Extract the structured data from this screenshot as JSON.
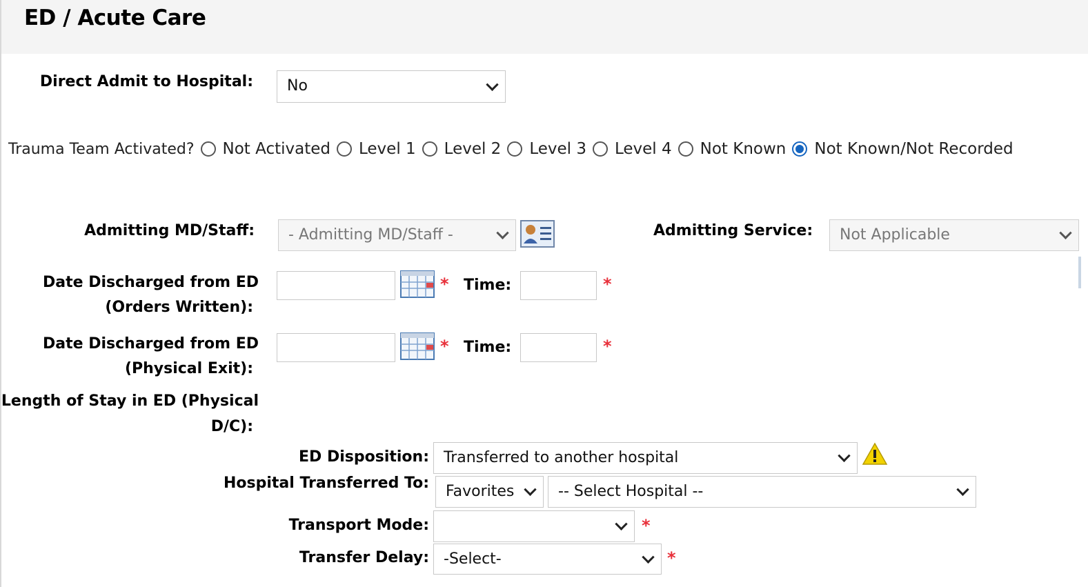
{
  "section": {
    "title": "ED / Acute Care"
  },
  "direct_admit": {
    "label": "Direct Admit to Hospital:",
    "value": "No"
  },
  "trauma": {
    "label": "Trauma Team Activated?",
    "options": [
      {
        "label": "Not Activated",
        "checked": false
      },
      {
        "label": "Level 1",
        "checked": false
      },
      {
        "label": "Level 2",
        "checked": false
      },
      {
        "label": "Level 3",
        "checked": false
      },
      {
        "label": "Level 4",
        "checked": false
      },
      {
        "label": "Not Known",
        "checked": false
      },
      {
        "label": "Not Known/Not Recorded",
        "checked": true
      }
    ]
  },
  "admitting_md": {
    "label": "Admitting MD/Staff:",
    "value": "- Admitting MD/Staff -"
  },
  "admitting_service": {
    "label": "Admitting Service:",
    "value": "Not Applicable"
  },
  "discharge_orders": {
    "label_line1": "Date Discharged from ED",
    "label_line2": "(Orders Written):",
    "date_value": "",
    "time_label": "Time:",
    "time_value": "",
    "required_mark": "*"
  },
  "discharge_exit": {
    "label_line1": "Date Discharged from ED",
    "label_line2": "(Physical Exit):",
    "date_value": "",
    "time_label": "Time:",
    "time_value": "",
    "required_mark": "*"
  },
  "length_of_stay": {
    "label_line1": "Length of Stay in ED (Physical",
    "label_line2": "D/C):"
  },
  "ed_disposition": {
    "label": "ED Disposition:",
    "value": "Transferred to another hospital"
  },
  "hospital_transferred": {
    "label": "Hospital Transferred To:",
    "filter_value": "Favorites",
    "hospital_value": "-- Select Hospital --"
  },
  "transport_mode": {
    "label": "Transport Mode:",
    "value": "",
    "required_mark": "*"
  },
  "transfer_delay": {
    "label": "Transfer Delay:",
    "value": "-Select-",
    "required_mark": "*"
  },
  "colors": {
    "required": "#e8303a",
    "radio_selected": "#1565c0",
    "warning": "#f2d200"
  }
}
